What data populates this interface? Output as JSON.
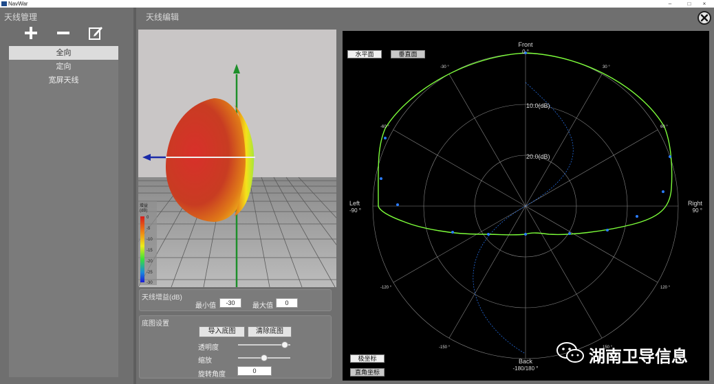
{
  "window": {
    "title": "NavWar",
    "min_glyph": "–",
    "max_glyph": "□",
    "close_glyph": "×"
  },
  "left_panel": {
    "title": "天线管理",
    "toolbar": {
      "add_icon": "plus-icon",
      "remove_icon": "minus-icon",
      "edit_icon": "edit-icon"
    },
    "items": [
      {
        "label": "全向",
        "selected": true
      },
      {
        "label": "定向",
        "selected": false
      },
      {
        "label": "宽屏天线",
        "selected": false
      }
    ]
  },
  "editor": {
    "title": "天线编辑",
    "legend": {
      "title_line1": "增益",
      "title_line2": "(dB)",
      "ticks": [
        "0",
        "-5",
        "-10",
        "-15",
        "-20",
        "-25",
        "-30"
      ]
    },
    "gain_panel": {
      "title": "天线增益(dB)",
      "min_label": "最小值",
      "min_value": "-30",
      "max_label": "最大值",
      "max_value": "0"
    },
    "basemap_panel": {
      "title": "底图设置",
      "import_label": "导入底图",
      "clear_label": "清除底图",
      "opacity_label": "透明度",
      "opacity_fraction": 0.95,
      "zoom_label": "缩放",
      "zoom_fraction": 0.5,
      "rotation_label": "旋转角度",
      "rotation_value": "0"
    }
  },
  "polar": {
    "view_buttons": {
      "horizontal": "水平面",
      "vertical": "垂直面"
    },
    "coord_buttons": {
      "polar": "极坐标",
      "cartesian": "直角坐标"
    },
    "front_label": "Front",
    "front_angle": "0 °",
    "back_label": "Back",
    "back_angle": "-180/180 °",
    "left_label": "Left",
    "left_angle": "-90 °",
    "right_label": "Right",
    "right_angle": "90 °",
    "ring_labels": [
      "10.0(dB)",
      "20.0(dB)"
    ],
    "angle_labels": {
      "a_neg30": "-30 °",
      "a_30": "30 °",
      "a_neg60": "-60 °",
      "a_60": "60 °",
      "a_neg120": "-120 °",
      "a_120": "120 °",
      "a_neg150": "-150 °",
      "a_150": "150 °"
    },
    "colors": {
      "pattern": "#7dff3a",
      "markers": "#2a7cff",
      "grid": "#8a8a8a"
    }
  },
  "watermark": {
    "text": "湖南卫导信息",
    "icon": "wechat-icon"
  }
}
